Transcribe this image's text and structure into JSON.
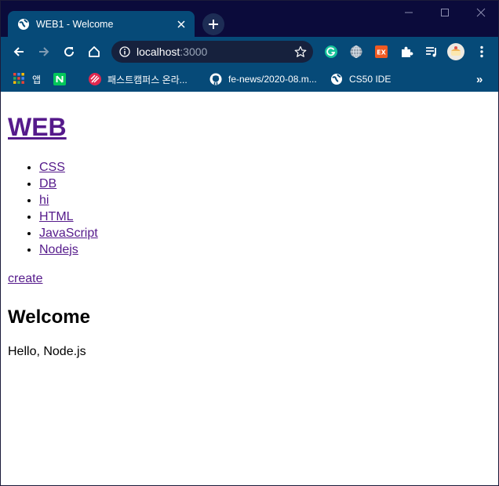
{
  "browser": {
    "tab": {
      "title": "WEB1 - Welcome",
      "favicon": "globe-icon"
    },
    "new_tab_icon": "plus-icon",
    "window_controls": [
      "minimize-icon",
      "maximize-icon",
      "close-icon"
    ],
    "address_bar": {
      "host": "localhost",
      "port": ":3000"
    },
    "extensions": [
      "grammarly-icon",
      "globe-extension-icon",
      "ex-extension-icon",
      "puzzle-icon",
      "media-control-icon",
      "profile-avatar",
      "more-menu-icon"
    ],
    "bookmarks": [
      {
        "label": "앱",
        "icon": "apps-grid-icon"
      },
      {
        "label": "",
        "icon": "naver-icon"
      },
      {
        "label": "패스트캠퍼스 온라...",
        "icon": "fastcampus-icon"
      },
      {
        "label": "fe-news/2020-08.m...",
        "icon": "github-icon"
      },
      {
        "label": "CS50 IDE",
        "icon": "globe-icon"
      }
    ],
    "bookmarks_overflow": "»"
  },
  "page": {
    "title": "WEB",
    "nav_items": [
      "CSS",
      "DB",
      "hi",
      "HTML",
      "JavaScript",
      "Nodejs"
    ],
    "create_link": "create",
    "heading": "Welcome",
    "body": "Hello, Node.js"
  },
  "colors": {
    "tab_strip": "#0b0b3b",
    "toolbar": "#064a78",
    "omnibox": "#16213d",
    "link_visited": "#551a8b"
  }
}
